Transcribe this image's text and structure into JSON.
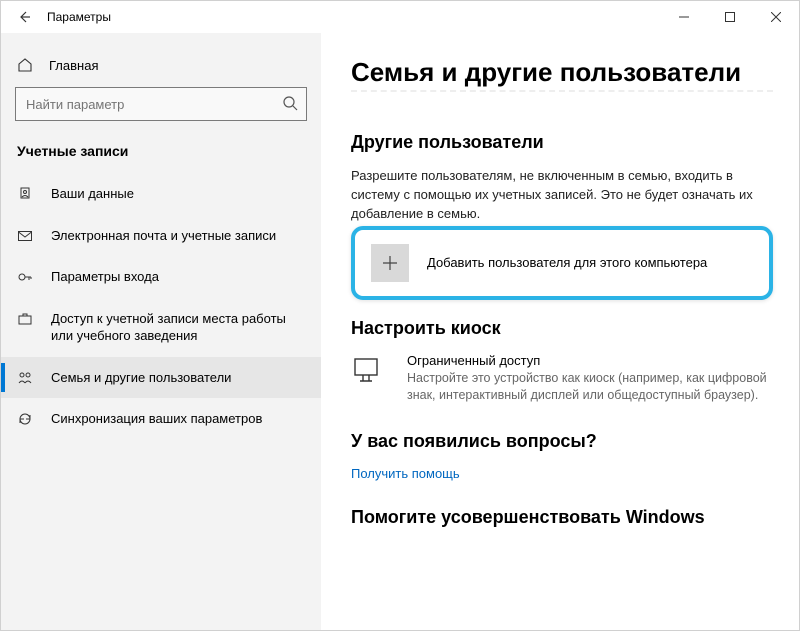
{
  "titlebar": {
    "app_title": "Параметры"
  },
  "sidebar": {
    "home_label": "Главная",
    "search_placeholder": "Найти параметр",
    "section_header": "Учетные записи",
    "items": [
      {
        "label": "Ваши данные"
      },
      {
        "label": "Электронная почта и учетные записи"
      },
      {
        "label": "Параметры входа"
      },
      {
        "label": "Доступ к учетной записи места работы или учебного заведения"
      },
      {
        "label": "Семья и другие пользователи"
      },
      {
        "label": "Синхронизация ваших параметров"
      }
    ]
  },
  "content": {
    "page_title": "Семья и другие пользователи",
    "other_users_header": "Другие пользователи",
    "other_users_desc": "Разрешите пользователям, не включенным в семью, входить в систему с помощью их учетных записей. Это не будет означать их добавление в семью.",
    "add_user_label": "Добавить пользователя для этого компьютера",
    "kiosk_header": "Настроить киоск",
    "kiosk_title": "Ограниченный доступ",
    "kiosk_desc": "Настройте это устройство как киоск (например, как цифровой знак, интерактивный дисплей или общедоступный браузер).",
    "questions_header": "У вас появились вопросы?",
    "help_link": "Получить помощь",
    "improve_header": "Помогите усовершенствовать Windows"
  }
}
